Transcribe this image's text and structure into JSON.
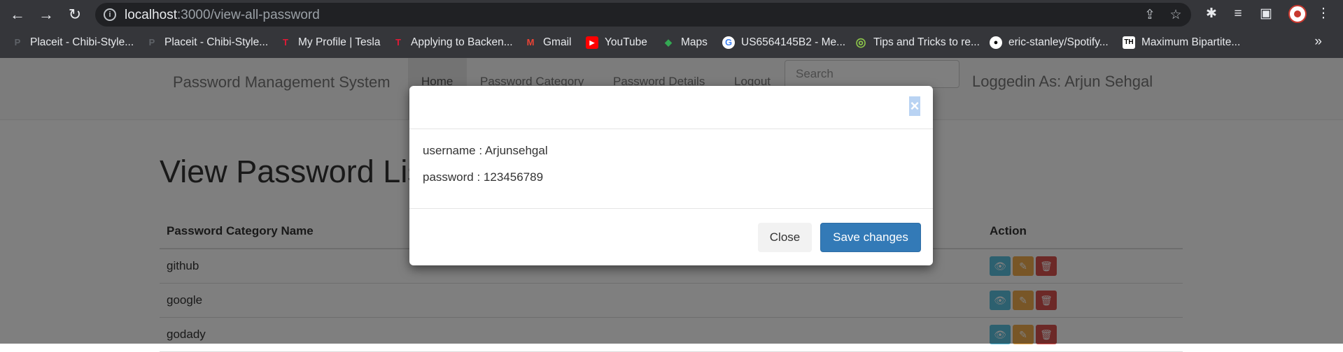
{
  "browser": {
    "url_host": "localhost",
    "url_rest": ":3000/view-all-password",
    "bookmarks": [
      {
        "label": "Placeit - Chibi-Style...",
        "icon": "placeit-icon"
      },
      {
        "label": "Placeit - Chibi-Style...",
        "icon": "placeit-icon"
      },
      {
        "label": "My Profile | Tesla",
        "icon": "tesla-icon"
      },
      {
        "label": "Applying to Backen...",
        "icon": "tesla-icon"
      },
      {
        "label": "Gmail",
        "icon": "gmail-icon"
      },
      {
        "label": "YouTube",
        "icon": "youtube-icon"
      },
      {
        "label": "Maps",
        "icon": "maps-icon"
      },
      {
        "label": "US6564145B2 - Me...",
        "icon": "google-icon"
      },
      {
        "label": "Tips and Tricks to re...",
        "icon": "ring-icon"
      },
      {
        "label": "eric-stanley/Spotify...",
        "icon": "github-icon"
      },
      {
        "label": "Maximum Bipartite...",
        "icon": "th-icon"
      }
    ],
    "more_label": "»"
  },
  "navbar": {
    "brand": "Password Management System",
    "links": [
      "Home",
      "Password Category",
      "Password Details",
      "Logout"
    ],
    "search_placeholder": "Search",
    "logged_in": "Loggedin As: Arjun Sehgal"
  },
  "main": {
    "title": "View Password List",
    "columns": [
      "Password Category Name",
      "Action"
    ],
    "rows": [
      "github",
      "google",
      "godady"
    ]
  },
  "modal": {
    "close_symbol": "×",
    "username_line": "username : Arjunsehgal",
    "password_line": "password : 123456789",
    "close_label": "Close",
    "save_label": "Save changes"
  },
  "colors": {
    "view": "#5bc0de",
    "edit": "#f0ad4e",
    "delete": "#d9534f",
    "primary": "#337ab7"
  }
}
